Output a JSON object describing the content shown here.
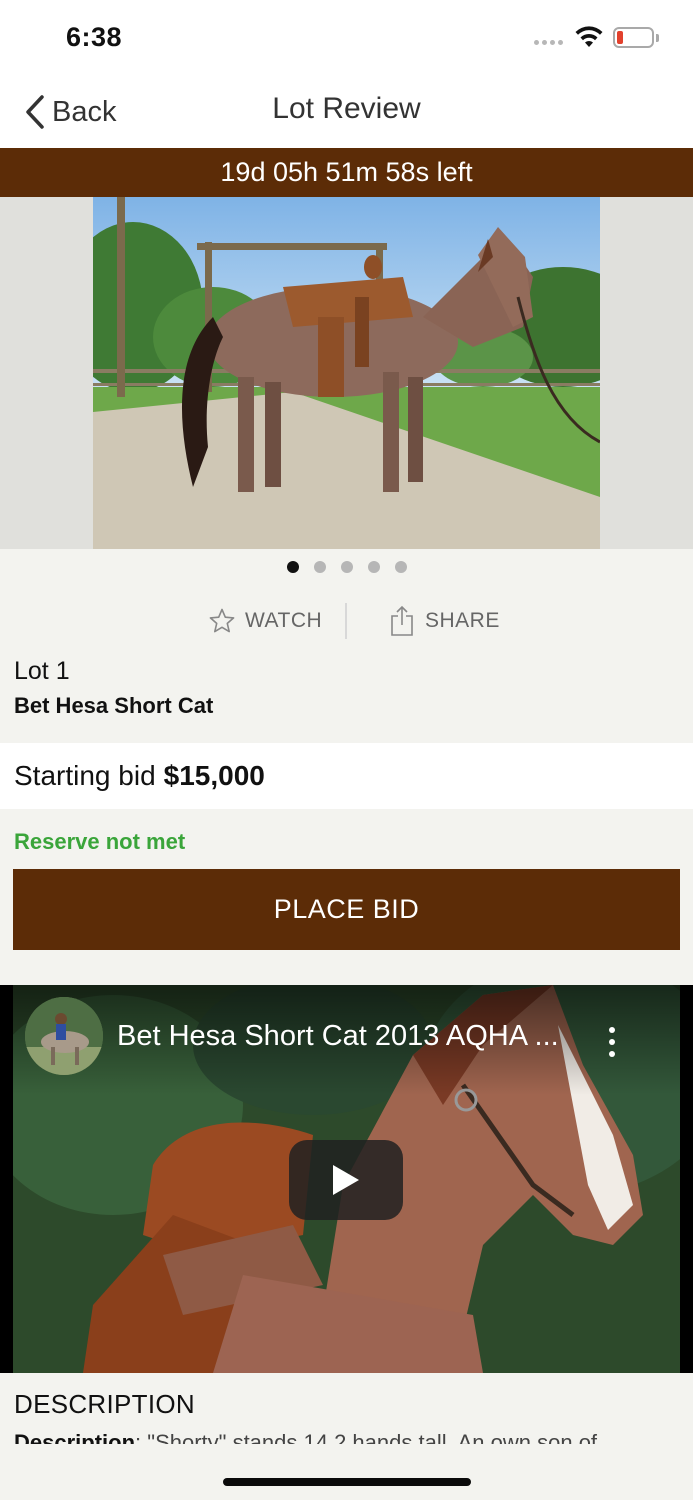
{
  "status_bar": {
    "time": "6:38",
    "wifi_icon": "wifi-icon",
    "battery_icon": "battery-low-icon",
    "battery_color": "#e2412d"
  },
  "nav": {
    "back_label": "Back",
    "back_icon": "chevron-left-icon",
    "title": "Lot Review"
  },
  "countdown": {
    "text": "19d 05h 51m 58s left"
  },
  "gallery": {
    "photo_count": 5,
    "active_index": 0
  },
  "actions": {
    "watch_label": "WATCH",
    "watch_icon": "star-outline-icon",
    "share_label": "SHARE",
    "share_icon": "share-icon"
  },
  "lot": {
    "number": "Lot 1",
    "name": "Bet Hesa Short Cat"
  },
  "bid": {
    "label": "Starting bid",
    "amount": "$15,000"
  },
  "reserve": {
    "text": "Reserve not met",
    "color": "#3aa53a"
  },
  "place_bid": {
    "label": "PLACE BID",
    "color": "#5c2c07"
  },
  "video": {
    "title": "Bet Hesa Short Cat 2013 AQHA ...",
    "play_icon": "play-icon",
    "menu_icon": "more-vertical-icon"
  },
  "description": {
    "heading": "DESCRIPTION",
    "label": "Description",
    "text": ": \"Shorty\" stands 14.2 hands tall.  An own son of"
  }
}
